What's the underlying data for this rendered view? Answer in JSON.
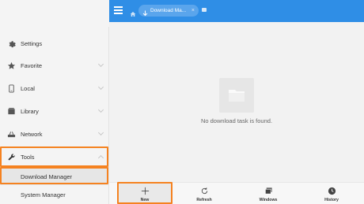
{
  "header": {
    "breadcrumb": "Download Ma..."
  },
  "sidebar": {
    "items": [
      {
        "label": "Settings",
        "icon": "gear-icon"
      },
      {
        "label": "Favorite",
        "icon": "star-icon"
      },
      {
        "label": "Local",
        "icon": "phone-icon"
      },
      {
        "label": "Library",
        "icon": "library-icon"
      },
      {
        "label": "Network",
        "icon": "router-icon"
      },
      {
        "label": "Tools",
        "icon": "wrench-icon"
      }
    ],
    "tools_subitems": [
      {
        "label": "Download Manager",
        "selected": true
      },
      {
        "label": "System Manager",
        "selected": false
      }
    ]
  },
  "main": {
    "empty_message": "No download task is found."
  },
  "toolbar": {
    "new_label": "New",
    "refresh_label": "Refresh",
    "windows_label": "Windows",
    "history_label": "History"
  },
  "colors": {
    "accent": "#2f8ee6",
    "highlight": "#f58220"
  }
}
